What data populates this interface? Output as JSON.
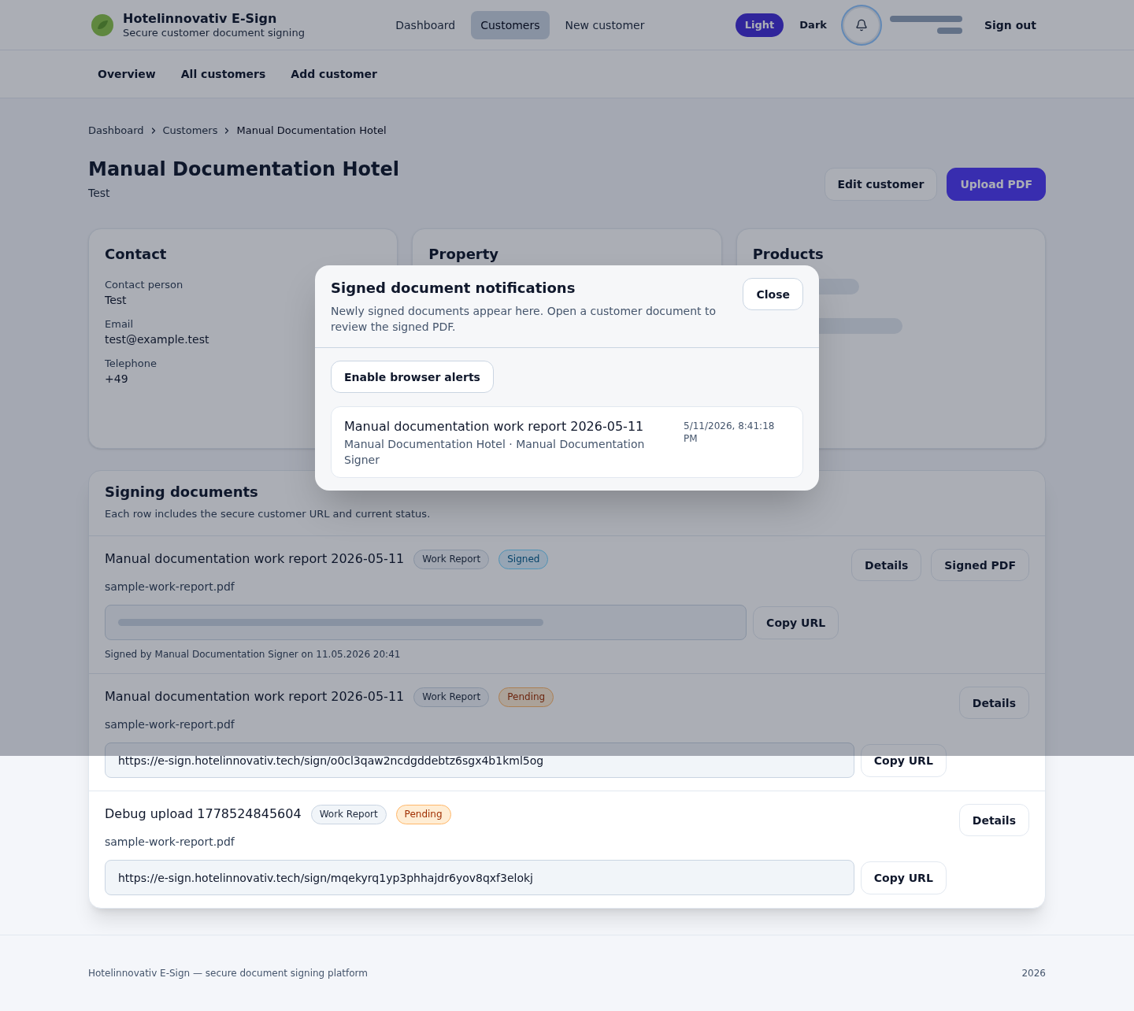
{
  "header": {
    "brand": {
      "name": "Hotelinnovativ E-Sign",
      "tagline": "Secure customer document signing"
    },
    "nav": [
      {
        "label": "Dashboard",
        "selected": false
      },
      {
        "label": "Customers",
        "selected": true
      },
      {
        "label": "New customer",
        "selected": false
      }
    ],
    "theme_toggle": [
      {
        "label": "Light",
        "selected": true
      },
      {
        "label": "Dark",
        "selected": false
      }
    ],
    "sign_out": "Sign out"
  },
  "subnav": [
    "Overview",
    "All customers",
    "Add customer"
  ],
  "breadcrumb": [
    "Dashboard",
    "Customers",
    "Manual Documentation Hotel"
  ],
  "page": {
    "title": "Manual Documentation Hotel",
    "subtitle": "Test",
    "actions": [
      {
        "label": "Edit customer",
        "kind": "secondary"
      },
      {
        "label": "Upload PDF",
        "kind": "primary"
      }
    ]
  },
  "cards": [
    {
      "title": "Contact",
      "kind": "fields",
      "fields": [
        {
          "label": "Contact person",
          "value": "Test"
        },
        {
          "label": "Email",
          "value": "test@example.test"
        },
        {
          "label": "Telephone",
          "value": "+49"
        }
      ]
    },
    {
      "title": "Property",
      "kind": "fields"
    },
    {
      "title": "Products",
      "kind": "tags"
    }
  ],
  "signing": {
    "title": "Signing documents",
    "subtitle": "Each row includes the secure customer URL and current status.",
    "documents": [
      {
        "title": "Manual documentation work report 2026-05-11",
        "type": "Work Report",
        "status": {
          "label": "Signed",
          "kind": "signed"
        },
        "file": "sample-work-report.pdf",
        "copy_label": "Copy URL",
        "note": "Signed by Manual Documentation Signer on 11.05.2026 20:41",
        "actions": [
          "Details",
          "Signed PDF"
        ]
      },
      {
        "title": "Manual documentation work report 2026-05-11",
        "type": "Work Report",
        "status": {
          "label": "Pending",
          "kind": "pending"
        },
        "file": "sample-work-report.pdf",
        "url": "https://e-sign.hotelinnovativ.tech/sign/o0cl3qaw2ncdgddebtz6sgx4b1kml5og",
        "copy_label": "Copy URL",
        "actions": [
          "Details"
        ]
      },
      {
        "title": "Debug upload 1778524845604",
        "type": "Work Report",
        "status": {
          "label": "Pending",
          "kind": "pending"
        },
        "file": "sample-work-report.pdf",
        "url": "https://e-sign.hotelinnovativ.tech/sign/mqekyrq1yp3phhajdr6yov8qxf3elokj",
        "copy_label": "Copy URL",
        "actions": [
          "Details"
        ]
      }
    ]
  },
  "footer": {
    "text": "Hotelinnovativ E-Sign — secure document signing platform",
    "year": "2026"
  },
  "modal": {
    "title": "Signed document notifications",
    "description": "Newly signed documents appear here. Open a customer document to review the signed PDF.",
    "close": "Close",
    "enable_alerts": "Enable browser alerts",
    "notifications": [
      {
        "title": "Manual documentation work report 2026-05-11",
        "meta": "Manual Documentation Hotel · Manual Documentation Signer",
        "time": "5/11/2026, 8:41:18 PM"
      }
    ]
  }
}
